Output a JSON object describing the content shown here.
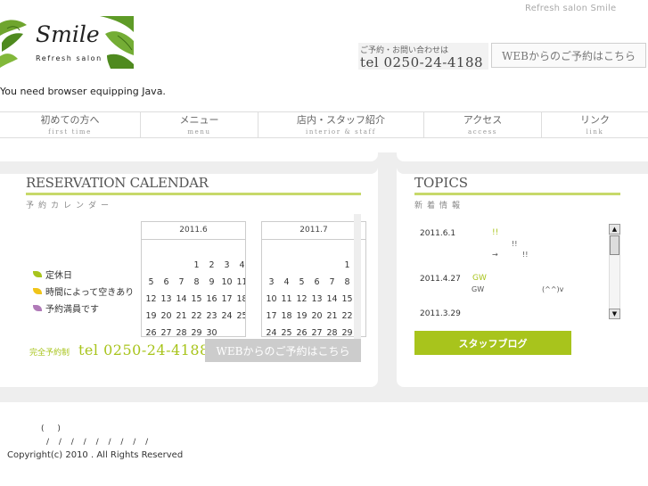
{
  "header": {
    "site_name": "Refresh salon  Smile",
    "logo_title": "Smile",
    "logo_subtitle": "Refresh  salon",
    "contact_label": "ご予約・お問い合わせは",
    "contact_tel": "tel 0250-24-4188",
    "web_reserve": "WEBからのご予約はこちら",
    "java_message": "You need browser equipping Java."
  },
  "nav": {
    "items": [
      {
        "ja": "初めての方へ",
        "en": "first time"
      },
      {
        "ja": "メニュー",
        "en": "menu"
      },
      {
        "ja": "店内・スタッフ紹介",
        "en": "interior & staff"
      },
      {
        "ja": "アクセス",
        "en": "access"
      },
      {
        "ja": "リンク",
        "en": "link"
      }
    ]
  },
  "calendar": {
    "title": "RESERVATION CALENDAR",
    "subtitle": "予約カレンダー",
    "legend": [
      {
        "label": "定休日",
        "color": "#a8c41c"
      },
      {
        "label": "時間によって空きあり",
        "color": "#f0c419"
      },
      {
        "label": "予約満員です",
        "color": "#b07ab8"
      }
    ],
    "months": [
      {
        "label": "2011.6",
        "rows": [
          [
            "",
            "",
            "",
            "1",
            "2",
            "3",
            "4"
          ],
          [
            "5",
            "6",
            "7",
            "8",
            "9",
            "10",
            "11"
          ],
          [
            "12",
            "13",
            "14",
            "15",
            "16",
            "17",
            "18"
          ],
          [
            "19",
            "20",
            "21",
            "22",
            "23",
            "24",
            "25"
          ],
          [
            "26",
            "27",
            "28",
            "29",
            "30",
            "",
            ""
          ]
        ]
      },
      {
        "label": "2011.7",
        "rows": [
          [
            "",
            "",
            "",
            "",
            "",
            "1",
            ""
          ],
          [
            "3",
            "4",
            "5",
            "6",
            "7",
            "8",
            ""
          ],
          [
            "10",
            "11",
            "12",
            "13",
            "14",
            "15",
            ""
          ],
          [
            "17",
            "18",
            "19",
            "20",
            "21",
            "22",
            ""
          ],
          [
            "24",
            "25",
            "26",
            "27",
            "28",
            "29",
            ""
          ]
        ]
      }
    ],
    "footer_label": "完全予約制",
    "footer_tel": "tel 0250-24-4188",
    "web_reserve": "WEBからのご予約はこちら"
  },
  "topics": {
    "title": "TOPICS",
    "subtitle": "新着情報",
    "items": [
      {
        "date": "2011.6.1",
        "tag": "!!",
        "notes": [
          "!!",
          "→",
          "!!"
        ]
      },
      {
        "date": "2011.4.27",
        "tag": "GW",
        "notes": [
          "GW",
          "(^^)v"
        ]
      },
      {
        "date": "2011.3.29",
        "tag": "",
        "notes": []
      }
    ],
    "scroll_up": "▲",
    "scroll_down": "▼",
    "staff_blog": "スタッフブログ"
  },
  "footer": {
    "line1": "(  )",
    "line2": "/ /    /  /    /    /    / / /",
    "copyright": "Copyright(c) 2010           . All Rights Reserved"
  },
  "colors": {
    "accent": "#a8c41c",
    "accent_light": "#c7d96a",
    "panel_bg": "#eeeeee"
  }
}
